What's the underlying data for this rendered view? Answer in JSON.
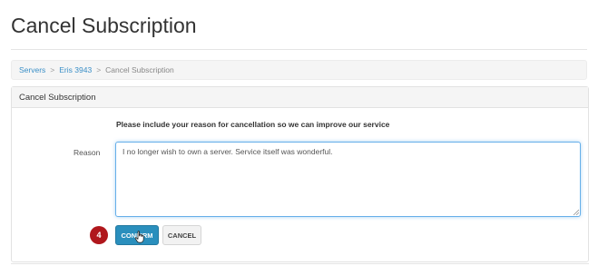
{
  "page": {
    "title": "Cancel Subscription"
  },
  "breadcrumb": {
    "items": [
      "Servers",
      "Eris 3943"
    ],
    "separator": ">",
    "current": "Cancel Subscription"
  },
  "panel": {
    "heading": "Cancel Subscription",
    "instruction": "Please include your reason for cancellation so we can improve our service",
    "reason_label": "Reason",
    "reason_value": "I no longer wish to own a server. Service itself was wonderful.",
    "confirm_label": "Confirm",
    "cancel_label": "Cancel"
  },
  "annotation": {
    "step_number": "4"
  },
  "colors": {
    "accent": "#2a8fbd",
    "link": "#3a8fc7",
    "badge": "#b0171c",
    "focus": "#66afe9"
  },
  "icons": {
    "cursor": "hand-pointer-icon",
    "grip": "resize-grip-icon"
  }
}
